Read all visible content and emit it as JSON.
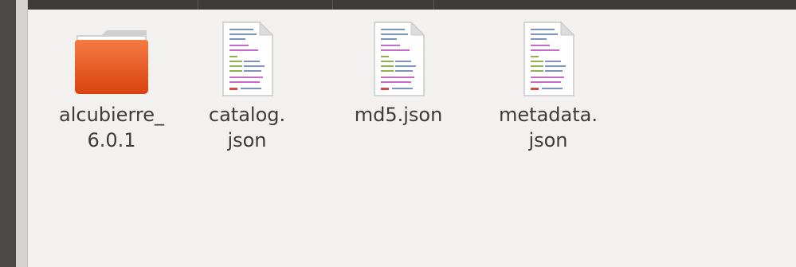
{
  "window": {
    "accent": "#3c3b37",
    "background": "#f2f1f0"
  },
  "files": [
    {
      "name_line1": "alcubierre_",
      "name_line2": "6.0.1",
      "type": "folder",
      "icon": "folder-icon",
      "icon_color": "#e9541f"
    },
    {
      "name_line1": "catalog.",
      "name_line2": "json",
      "type": "file",
      "icon": "text-document-icon"
    },
    {
      "name_line1": "md5.json",
      "name_line2": "",
      "type": "file",
      "icon": "text-document-icon"
    },
    {
      "name_line1": "metadata.",
      "name_line2": "json",
      "type": "file",
      "icon": "text-document-icon"
    }
  ]
}
